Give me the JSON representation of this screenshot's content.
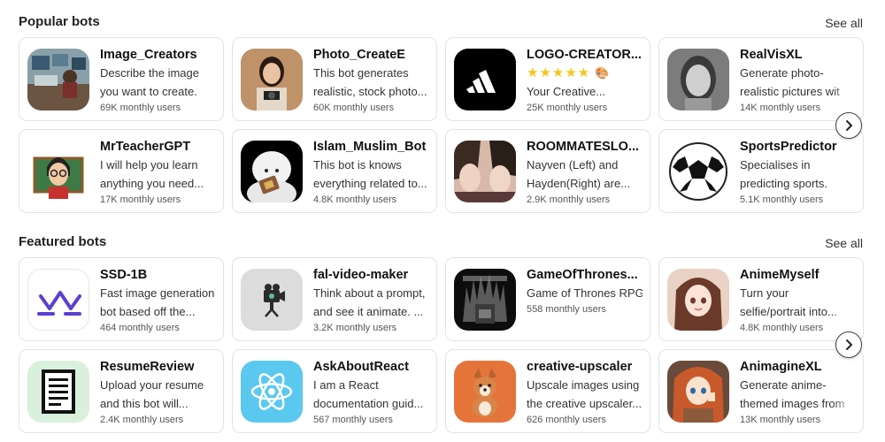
{
  "sections": {
    "popular": {
      "title": "Popular bots",
      "see_all": "See all"
    },
    "featured": {
      "title": "Featured bots",
      "see_all": "See all"
    }
  },
  "popular_bots": [
    {
      "name": "Image_Creators",
      "desc1": "Describe the image",
      "desc2": "you want to create.",
      "users": "69K monthly users"
    },
    {
      "name": "Photo_CreateE",
      "desc1": "This bot generates",
      "desc2": "realistic, stock photo...",
      "users": "60K monthly users"
    },
    {
      "name": "LOGO-CREATOR...",
      "desc1": "★★★★★",
      "desc2": "Your Creative...",
      "users": "25K monthly users"
    },
    {
      "name": "RealVisXL",
      "desc1": "Generate photo-",
      "desc2": "realistic pictures wit",
      "users": "14K monthly users"
    },
    {
      "name": "MrTeacherGPT",
      "desc1": "I will help you learn",
      "desc2": "anything you need...",
      "users": "17K monthly users"
    },
    {
      "name": "Islam_Muslim_Bot",
      "desc1": "This bot is knows",
      "desc2": "everything related to...",
      "users": "4.8K monthly users"
    },
    {
      "name": "ROOMMATESLO...",
      "desc1": "Nayven (Left) and",
      "desc2": "Hayden(Right) are...",
      "users": "2.9K monthly users"
    },
    {
      "name": "SportsPredictor",
      "desc1": "Specialises in",
      "desc2": "predicting sports.",
      "users": "5.1K monthly users"
    }
  ],
  "featured_bots": [
    {
      "name": "SSD-1B",
      "desc1": "Fast image generation",
      "desc2": "bot based off the...",
      "users": "464 monthly users"
    },
    {
      "name": "fal-video-maker",
      "desc1": "Think about a prompt,",
      "desc2": "and see it animate. ...",
      "users": "3.2K monthly users"
    },
    {
      "name": "GameOfThrones...",
      "desc1": "Game of Thrones RPG",
      "desc2": "",
      "users": "558 monthly users"
    },
    {
      "name": "AnimeMyself",
      "desc1": "Turn your",
      "desc2": "selfie/portrait into...",
      "users": "4.8K monthly users"
    },
    {
      "name": "ResumeReview",
      "desc1": "Upload your resume",
      "desc2": "and this bot will...",
      "users": "2.4K monthly users"
    },
    {
      "name": "AskAboutReact",
      "desc1": "I am a React",
      "desc2": "documentation guid...",
      "users": "567 monthly users"
    },
    {
      "name": "creative-upscaler",
      "desc1": "Upscale images using",
      "desc2": "the creative upscaler...",
      "users": "626 monthly users"
    },
    {
      "name": "AnimagineXL",
      "desc1": "Generate anime-",
      "desc2": "themed images from",
      "users": "13K monthly users"
    }
  ],
  "icons": {
    "next": "chevron-right-icon",
    "rating": "star-icon",
    "palette": "palette-icon"
  },
  "colors": {
    "card_border": "#e3e3e3",
    "star": "#f5c518",
    "react_bg": "#5bc8f0",
    "ssd_purple": "#5b3fd0"
  }
}
